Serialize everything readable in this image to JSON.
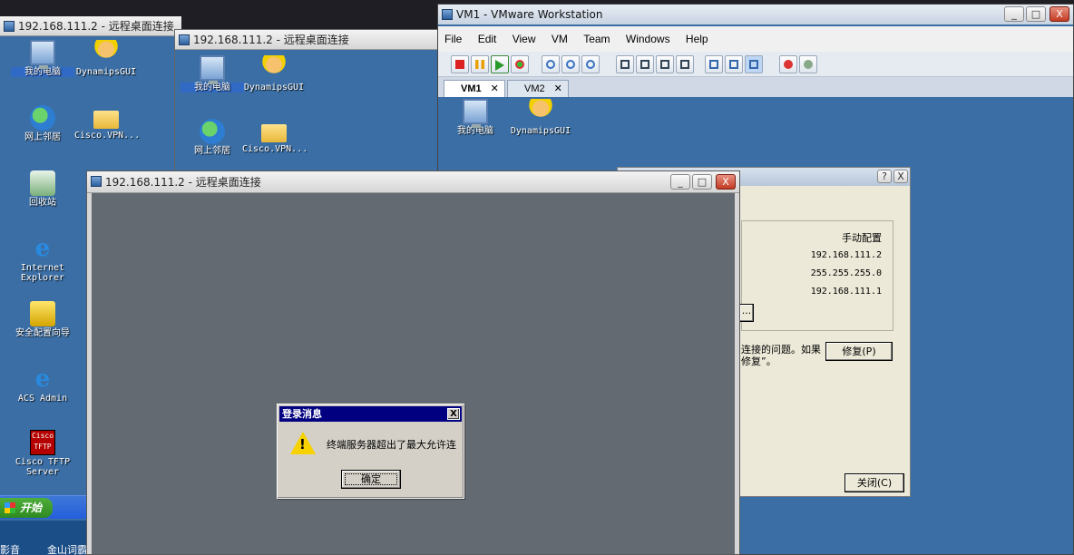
{
  "remote_windows": [
    {
      "title": "192.168.111.2 - 远程桌面连接"
    },
    {
      "title": "192.168.111.2 - 远程桌面连接"
    },
    {
      "title": "192.168.111.2 - 远程桌面连接"
    }
  ],
  "left_desktop_icons": [
    {
      "label": "我的电脑",
      "icon": "computer-icon"
    },
    {
      "label": "DynamipsGUI",
      "icon": "dynamips-icon"
    },
    {
      "label": "网上邻居",
      "icon": "network-places-icon"
    },
    {
      "label": "Cisco.VPN...",
      "icon": "folder-icon"
    },
    {
      "label": "回收站",
      "icon": "recycle-bin-icon"
    },
    {
      "label": "Internet Explorer",
      "icon": "internet-explorer-icon"
    },
    {
      "label": "安全配置向导",
      "icon": "security-wizard-icon"
    },
    {
      "label": "ACS Admin",
      "icon": "acs-admin-icon"
    },
    {
      "label": "Cisco TFTP Server",
      "icon": "cisco-tftp-icon"
    }
  ],
  "tftp_icon_text": "Cisco TFTP",
  "taskbar": {
    "start_label": "开始"
  },
  "bottom_partial_labels": [
    "影音",
    "金山词霸"
  ],
  "second_desktop_icons": [
    {
      "label": "我的电脑"
    },
    {
      "label": "DynamipsGUI"
    },
    {
      "label": "网上邻居"
    },
    {
      "label": "Cisco.VPN..."
    }
  ],
  "vmware": {
    "title": "VM1 - VMware Workstation",
    "menu": [
      "File",
      "Edit",
      "View",
      "VM",
      "Team",
      "Windows",
      "Help"
    ],
    "tabs": [
      {
        "label": "VM1",
        "active": true
      },
      {
        "label": "VM2",
        "active": false
      }
    ],
    "desktop_icons": [
      {
        "label": "我的电脑"
      },
      {
        "label": "DynamipsGUI"
      }
    ],
    "caption_min": "_",
    "caption_max": "□",
    "caption_close": "X"
  },
  "net_dialog": {
    "help_btn": "?",
    "close_x": "X",
    "header": "手动配置",
    "ip": "192.168.111.2",
    "mask": "255.255.255.0",
    "gateway": "192.168.111.1",
    "browse_btn": "...",
    "text_line1": "连接的问题。如果",
    "text_line2": "修复”。",
    "repair_btn": "修复(P)",
    "close_btn": "关闭(C)"
  },
  "message_box": {
    "title": "登录消息",
    "close": "X",
    "text": "终端服务器超出了最大允许连",
    "ok": "确定",
    "icon": "warning-icon"
  }
}
